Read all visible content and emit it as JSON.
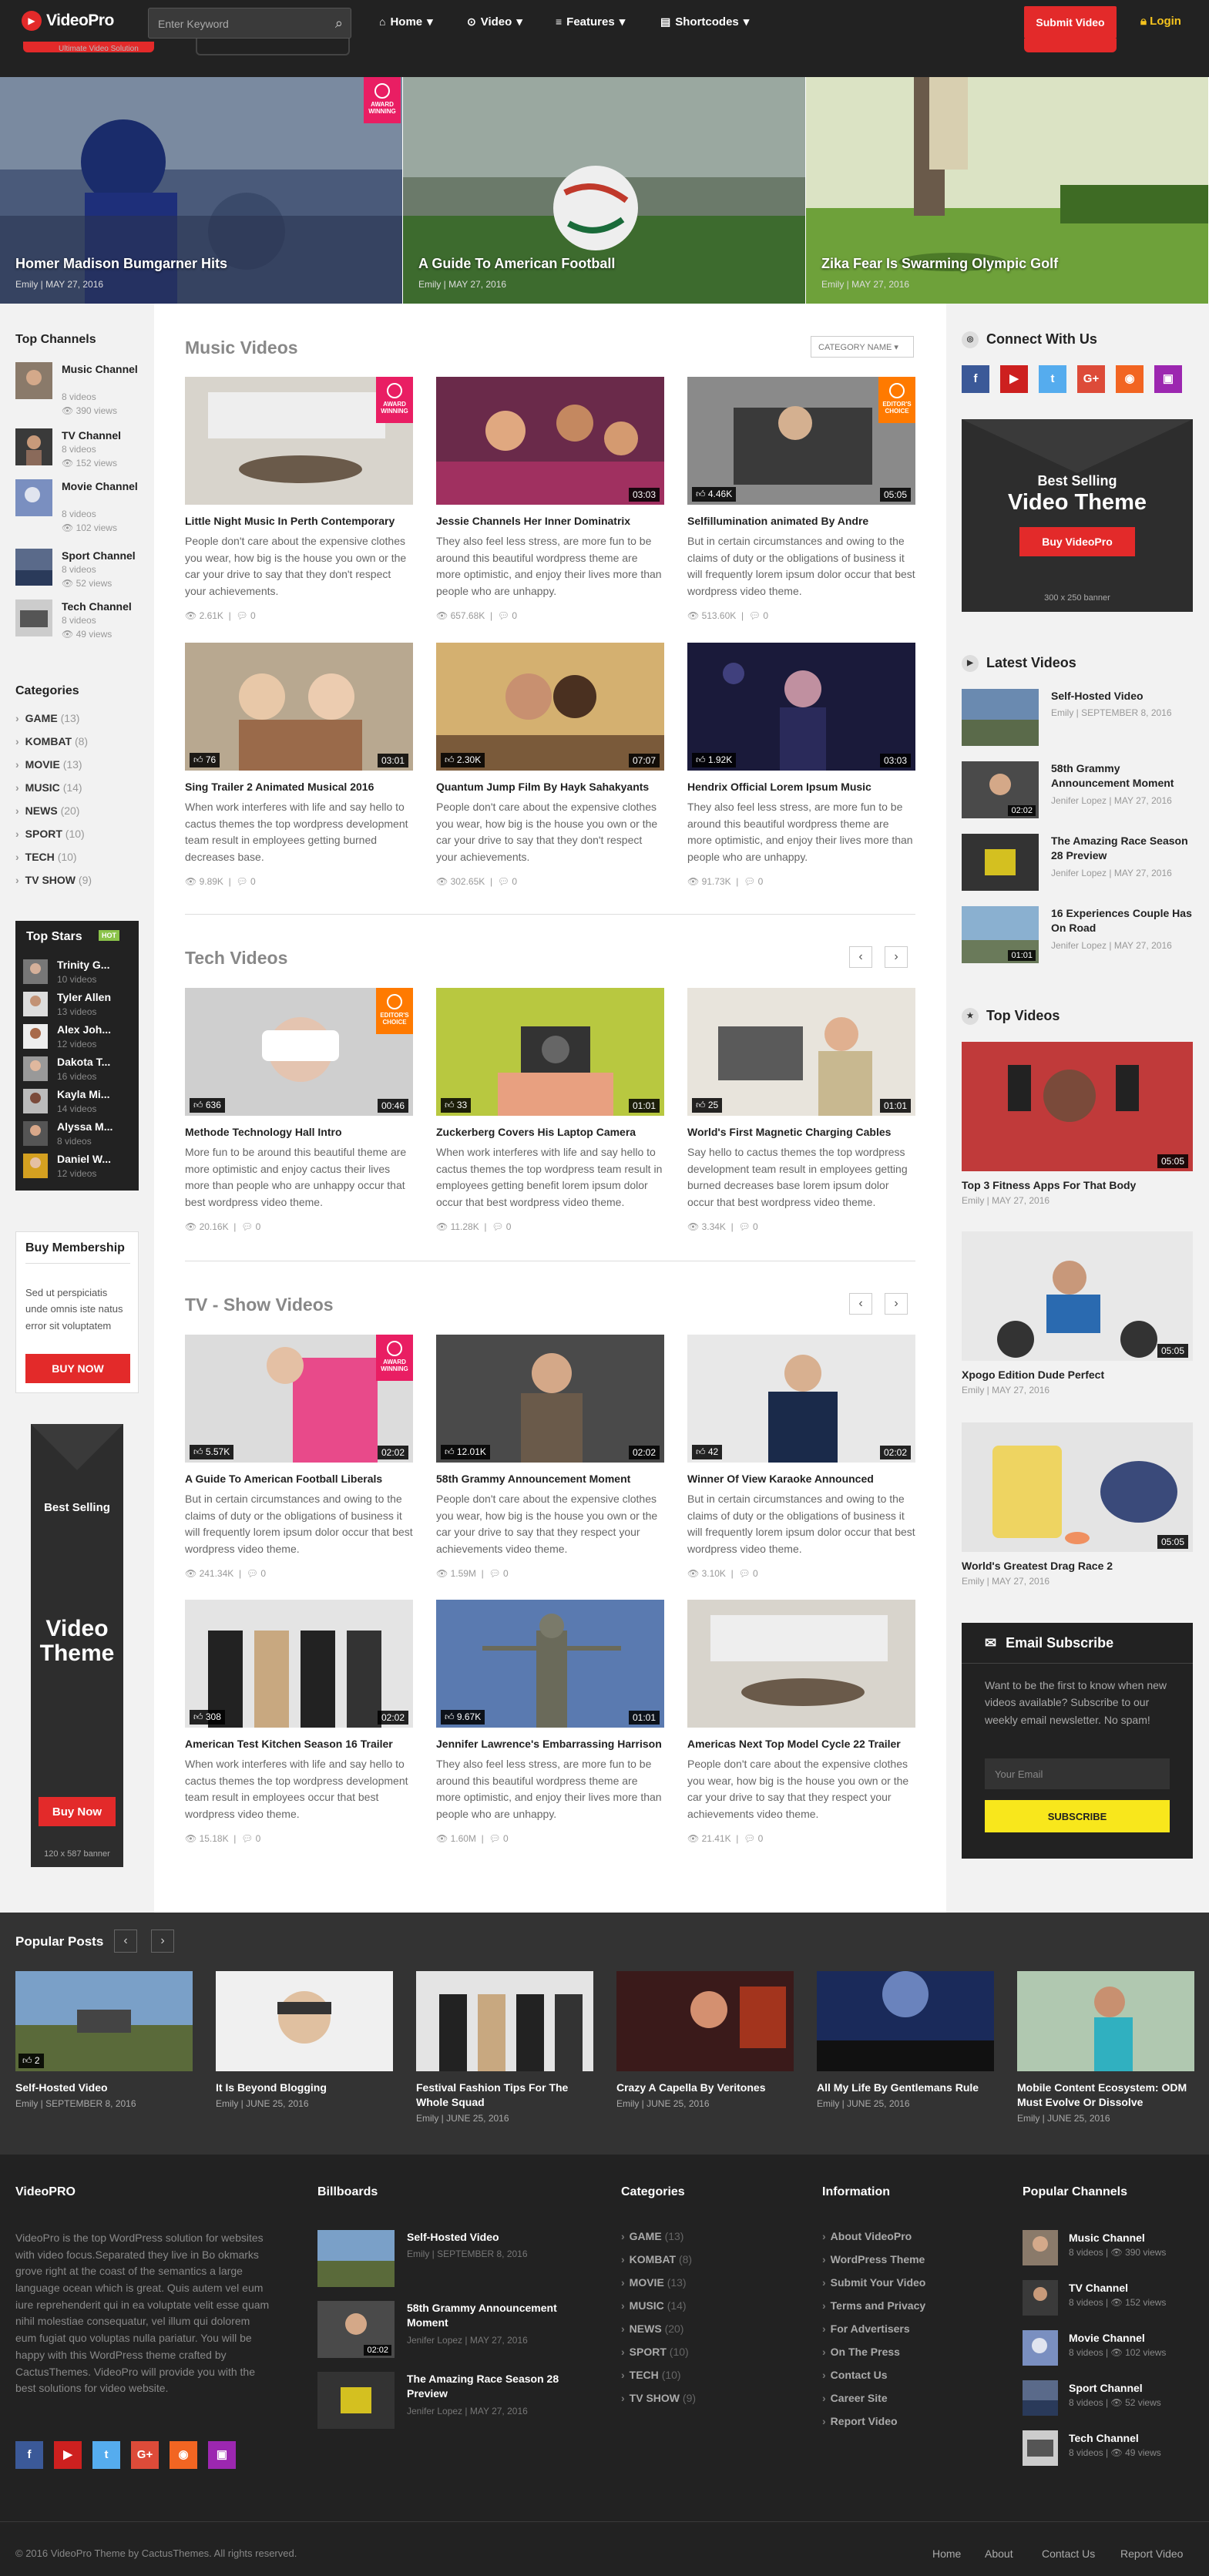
{
  "header": {
    "logo": "VideoPro",
    "tagline": "Ultimate Video Solution",
    "search_placeholder": "Enter Keyword",
    "nav": [
      "Home",
      "Video",
      "Features",
      "Shortcodes"
    ],
    "submit": "Submit Video",
    "login": "Login"
  },
  "hero": [
    {
      "title": "Homer Madison Bumgarner Hits",
      "author": "Emily",
      "date": "MAY 27, 2016",
      "award": "AWARD WINNING"
    },
    {
      "title": "A Guide To American Football",
      "author": "Emily",
      "date": "MAY 27, 2016"
    },
    {
      "title": "Zika Fear Is Swarming Olympic Golf",
      "author": "Emily",
      "date": "MAY 27, 2016"
    }
  ],
  "left": {
    "top_channels_title": "Top Channels",
    "channels": [
      {
        "name": "Music Channel",
        "videos": "8 videos",
        "views": "390 views"
      },
      {
        "name": "TV Channel",
        "videos": "8 videos",
        "views": "152 views"
      },
      {
        "name": "Movie Channel",
        "videos": "8 videos",
        "views": "102 views"
      },
      {
        "name": "Sport Channel",
        "videos": "8 videos",
        "views": "52 views"
      },
      {
        "name": "Tech Channel",
        "videos": "8 videos",
        "views": "49 views"
      }
    ],
    "categories_title": "Categories",
    "categories": [
      {
        "name": "GAME",
        "count": "(13)"
      },
      {
        "name": "KOMBAT",
        "count": "(8)"
      },
      {
        "name": "MOVIE",
        "count": "(13)"
      },
      {
        "name": "MUSIC",
        "count": "(14)"
      },
      {
        "name": "NEWS",
        "count": "(20)"
      },
      {
        "name": "SPORT",
        "count": "(10)"
      },
      {
        "name": "TECH",
        "count": "(10)"
      },
      {
        "name": "TV SHOW",
        "count": "(9)"
      }
    ],
    "stars_title": "Top Stars",
    "stars_badge": "HOT",
    "stars": [
      {
        "name": "Trinity G...",
        "videos": "10 videos"
      },
      {
        "name": "Tyler Allen",
        "videos": "13 videos"
      },
      {
        "name": "Alex Joh...",
        "videos": "12 videos"
      },
      {
        "name": "Dakota T...",
        "videos": "16 videos"
      },
      {
        "name": "Kayla Mi...",
        "videos": "14 videos"
      },
      {
        "name": "Alyssa M...",
        "videos": "8 videos"
      },
      {
        "name": "Daniel W...",
        "videos": "12 videos"
      }
    ],
    "membership": {
      "title": "Buy Membership",
      "text": "Sed ut perspiciatis unde omnis iste natus error sit voluptatem",
      "button": "BUY NOW"
    },
    "banner": {
      "best": "Best Selling",
      "video": "Video",
      "theme": "Theme",
      "button": "Buy Now",
      "size": "120 x 587 banner"
    }
  },
  "sections": [
    {
      "title": "Music Videos",
      "sort": "CATEGORY NAME",
      "videos": [
        {
          "title": "Little Night Music In Perth Contemporary",
          "desc": "People don't care about the expensive clothes you wear, how big is the house you own or the car your drive to say that they don't respect your achievements.",
          "views": "2.61K",
          "comments": "0",
          "award": "AWARD WINNING"
        },
        {
          "title": "Jessie Channels Her Inner Dominatrix",
          "desc": "They also feel less stress, are more fun to be around this beautiful wordpress theme are more optimistic, and enjoy their lives more than people who are unhappy.",
          "views": "657.68K",
          "comments": "0",
          "duration": "03:03"
        },
        {
          "title": "Selfillumination animated By Andre",
          "desc": "But in certain circumstances and owing to the claims of duty or the obligations of business it will frequently lorem ipsum dolor occur that best wordpress video theme.",
          "views": "513.60K",
          "comments": "0",
          "duration": "05:05",
          "likes": "4.46K",
          "award": "EDITOR'S CHOICE"
        },
        {
          "title": "Sing Trailer 2 Animated Musical 2016",
          "desc": "When work interferes with life and say hello to cactus themes the top wordpress development team result in employees getting burned decreases base.",
          "views": "9.89K",
          "comments": "0",
          "duration": "03:01",
          "likes": "76"
        },
        {
          "title": "Quantum Jump Film By Hayk Sahakyants",
          "desc": "People don't care about the expensive clothes you wear, how big is the house you own or the car your drive to say that they don't respect your achievements.",
          "views": "302.65K",
          "comments": "0",
          "duration": "07:07",
          "likes": "2.30K"
        },
        {
          "title": "Hendrix Official Lorem Ipsum Music",
          "desc": "They also feel less stress, are more fun to be around this beautiful wordpress theme are more optimistic, and enjoy their lives more than people who are unhappy.",
          "views": "91.73K",
          "comments": "0",
          "duration": "03:03",
          "likes": "1.92K"
        }
      ]
    },
    {
      "title": "Tech Videos",
      "videos": [
        {
          "title": "Methode Technology Hall Intro",
          "desc": "More fun to be around this beautiful theme are more optimistic and enjoy cactus their lives more than people who are unhappy occur that best wordpress video theme.",
          "views": "20.16K",
          "comments": "0",
          "duration": "00:46",
          "likes": "636",
          "award": "EDITOR'S CHOICE"
        },
        {
          "title": "Zuckerberg Covers His Laptop Camera",
          "desc": "When work interferes with life and say hello to cactus themes the top wordpress team result in employees getting benefit lorem ipsum dolor occur that best wordpress video theme.",
          "views": "11.28K",
          "comments": "0",
          "duration": "01:01",
          "likes": "33"
        },
        {
          "title": "World's First Magnetic Charging Cables",
          "desc": "Say hello to cactus themes the top wordpress development team result in employees getting burned decreases base lorem ipsum dolor occur that best wordpress video theme.",
          "views": "3.34K",
          "comments": "0",
          "duration": "01:01",
          "likes": "25"
        }
      ]
    },
    {
      "title": "TV - Show Videos",
      "videos": [
        {
          "title": "A Guide To American Football Liberals",
          "desc": "But in certain circumstances and owing to the claims of duty or the obligations of business it will frequently lorem ipsum dolor occur that best wordpress video theme.",
          "views": "241.34K",
          "comments": "0",
          "duration": "02:02",
          "likes": "5.57K",
          "award": "AWARD WINNING"
        },
        {
          "title": "58th Grammy Announcement Moment",
          "desc": "People don't care about the expensive clothes you wear, how big is the house you own or the car your drive to say that they respect your achievements video theme.",
          "views": "1.59M",
          "comments": "0",
          "duration": "02:02",
          "likes": "12.01K"
        },
        {
          "title": "Winner Of View Karaoke Announced",
          "desc": "But in certain circumstances and owing to the claims of duty or the obligations of business it will frequently lorem ipsum dolor occur that best wordpress video theme.",
          "views": "3.10K",
          "comments": "0",
          "duration": "02:02",
          "likes": "42"
        },
        {
          "title": "American Test Kitchen Season 16 Trailer",
          "desc": "When work interferes with life and say hello to cactus themes the top wordpress development team result in employees occur that best wordpress video theme.",
          "views": "15.18K",
          "comments": "0",
          "duration": "02:02",
          "likes": "308"
        },
        {
          "title": "Jennifer Lawrence's Embarrassing Harrison",
          "desc": "They also feel less stress, are more fun to be around this beautiful wordpress theme are more optimistic, and enjoy their lives more than people who are unhappy.",
          "views": "1.60M",
          "comments": "0",
          "duration": "01:01",
          "likes": "9.67K"
        },
        {
          "title": "Americas Next Top Model Cycle 22 Trailer",
          "desc": "People don't care about the expensive clothes you wear, how big is the house you own or the car your drive to say that they respect your achievements video theme.",
          "views": "21.41K",
          "comments": "0"
        }
      ]
    }
  ],
  "right": {
    "connect_title": "Connect With Us",
    "social": [
      "f",
      "▶",
      "t",
      "G+",
      "◉",
      "▣"
    ],
    "banner": {
      "best": "Best Selling",
      "theme": "Video Theme",
      "button": "Buy VideoPro",
      "size": "300 x 250 banner"
    },
    "latest_title": "Latest Videos",
    "latest": [
      {
        "title": "Self-Hosted Video",
        "author": "Emily",
        "date": "SEPTEMBER 8, 2016"
      },
      {
        "title": "58th Grammy Announcement Moment",
        "author": "Jenifer Lopez",
        "date": "MAY 27, 2016",
        "duration": "02:02"
      },
      {
        "title": "The Amazing Race Season 28 Preview",
        "author": "Jenifer Lopez",
        "date": "MAY 27, 2016"
      },
      {
        "title": "16 Experiences Couple Has On Road",
        "author": "Jenifer Lopez",
        "date": "MAY 27, 2016",
        "duration": "01:01"
      }
    ],
    "top_title": "Top Videos",
    "top": [
      {
        "title": "Top 3 Fitness Apps For That Body",
        "author": "Emily",
        "date": "MAY 27, 2016",
        "duration": "05:05"
      },
      {
        "title": "Xpogo Edition Dude Perfect",
        "author": "Emily",
        "date": "MAY 27, 2016",
        "duration": "05:05"
      },
      {
        "title": "World's Greatest Drag Race 2",
        "author": "Emily",
        "date": "MAY 27, 2016",
        "duration": "05:05"
      }
    ],
    "subscribe": {
      "title": "Email Subscribe",
      "text": "Want to be the first to know when new videos available? Subscribe to our weekly email newsletter. No spam!",
      "placeholder": "Your Email",
      "button": "SUBSCRIBE"
    }
  },
  "popular": {
    "title": "Popular Posts",
    "posts": [
      {
        "title": "Self-Hosted Video",
        "author": "Emily",
        "date": "SEPTEMBER 8, 2016",
        "likes": "2"
      },
      {
        "title": "It Is Beyond Blogging",
        "author": "Emily",
        "date": "JUNE 25, 2016"
      },
      {
        "title": "Festival Fashion Tips For The Whole Squad",
        "author": "Emily",
        "date": "JUNE 25, 2016"
      },
      {
        "title": "Crazy A Capella By Veritones",
        "author": "Emily",
        "date": "JUNE 25, 2016"
      },
      {
        "title": "All My Life By Gentlemans Rule",
        "author": "Emily",
        "date": "JUNE 25, 2016"
      },
      {
        "title": "Mobile Content Ecosystem: ODM Must Evolve Or Dissolve",
        "author": "Emily",
        "date": "JUNE 25, 2016"
      }
    ]
  },
  "footer": {
    "about_title": "VideoPRO",
    "about": "VideoPro is the top WordPress solution for websites with video focus.Separated they live in Bo okmarks grove right at the coast of the semantics a large language ocean which is great. Quis autem vel eum iure reprehenderit qui in ea voluptate velit esse quam nihil molestiae consequatur, vel illum qui dolorem eum fugiat quo voluptas nulla pariatur. You will be happy with this WordPress theme crafted by CactusThemes. VideoPro will provide you with the best solutions for video website.",
    "billboards_title": "Billboards",
    "billboards": [
      {
        "title": "Self-Hosted Video",
        "author": "Emily",
        "date": "SEPTEMBER 8, 2016"
      },
      {
        "title": "58th Grammy Announcement Moment",
        "author": "Jenifer Lopez",
        "date": "MAY 27, 2016",
        "duration": "02:02"
      },
      {
        "title": "The Amazing Race Season 28 Preview",
        "author": "Jenifer Lopez",
        "date": "MAY 27, 2016"
      }
    ],
    "categories_title": "Categories",
    "info_title": "Information",
    "info": [
      "About VideoPro",
      "WordPress Theme",
      "Submit Your Video",
      "Terms and Privacy",
      "For Advertisers",
      "On The Press",
      "Contact Us",
      "Career Site",
      "Report Video"
    ],
    "channels_title": "Popular Channels",
    "copyright": "© 2016 VideoPro Theme by CactusThemes. All rights reserved.",
    "links": [
      "Home",
      "About",
      "Contact Us",
      "Report Video"
    ]
  },
  "colors": {
    "accent": "#e32a2a",
    "dark": "#222222",
    "yellow": "#f8e71c",
    "award_pink": "#e91e63",
    "award_orange": "#ff7a00"
  }
}
